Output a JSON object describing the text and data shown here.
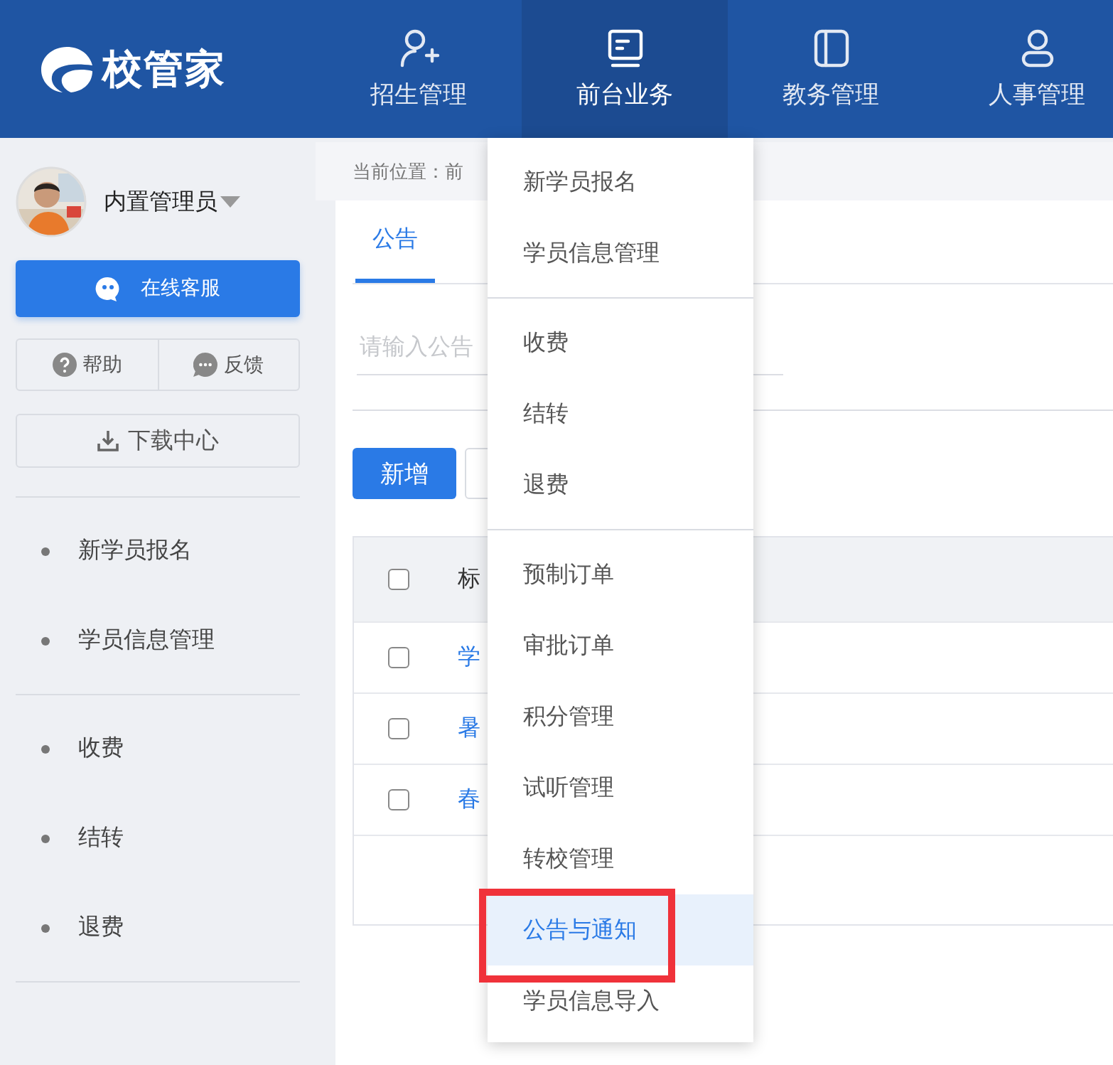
{
  "header": {
    "logo": "校管家",
    "nav": [
      {
        "label": "招生管理",
        "kind": "enroll",
        "selected": false
      },
      {
        "label": "前台业务",
        "kind": "front",
        "selected": true
      },
      {
        "label": "教务管理",
        "kind": "teaching",
        "selected": false
      },
      {
        "label": "人事管理",
        "kind": "staff",
        "selected": false
      }
    ]
  },
  "sidebar": {
    "user": {
      "name": "内置管理员"
    },
    "service_button": "在线客服",
    "help_buttons": [
      {
        "label": "帮助",
        "kind": "help"
      },
      {
        "label": "反馈",
        "kind": "feedback"
      }
    ],
    "download_button": "下载中心",
    "menu_groups": [
      [
        {
          "label": "新学员报名"
        },
        {
          "label": "学员信息管理"
        }
      ],
      [
        {
          "label": "收费"
        },
        {
          "label": "结转"
        },
        {
          "label": "退费"
        }
      ]
    ]
  },
  "breadcrumb": "当前位置：前",
  "tabs": [
    {
      "label": "公告",
      "selected": true
    }
  ],
  "search": {
    "placeholder": "请输入公告"
  },
  "toolbar": {
    "add_button": "新增"
  },
  "table": {
    "header_checked": false,
    "columns": [
      "标"
    ],
    "rows": [
      {
        "checked": false,
        "title": "学"
      },
      {
        "checked": false,
        "title": "暑"
      },
      {
        "checked": false,
        "title": "春"
      }
    ]
  },
  "dropdown": {
    "groups": [
      [
        {
          "label": "新学员报名",
          "selected": false,
          "annotated": false
        },
        {
          "label": "学员信息管理",
          "selected": false,
          "annotated": false
        }
      ],
      [
        {
          "label": "收费",
          "selected": false,
          "annotated": false
        },
        {
          "label": "结转",
          "selected": false,
          "annotated": false
        },
        {
          "label": "退费",
          "selected": false,
          "annotated": false
        }
      ],
      [
        {
          "label": "预制订单",
          "selected": false,
          "annotated": false
        },
        {
          "label": "审批订单",
          "selected": false,
          "annotated": false
        },
        {
          "label": "积分管理",
          "selected": false,
          "annotated": false
        },
        {
          "label": "试听管理",
          "selected": false,
          "annotated": false
        },
        {
          "label": "转校管理",
          "selected": false,
          "annotated": false
        },
        {
          "label": "公告与通知",
          "selected": true,
          "annotated": true
        },
        {
          "label": "学员信息导入",
          "selected": false,
          "annotated": false
        }
      ]
    ]
  }
}
